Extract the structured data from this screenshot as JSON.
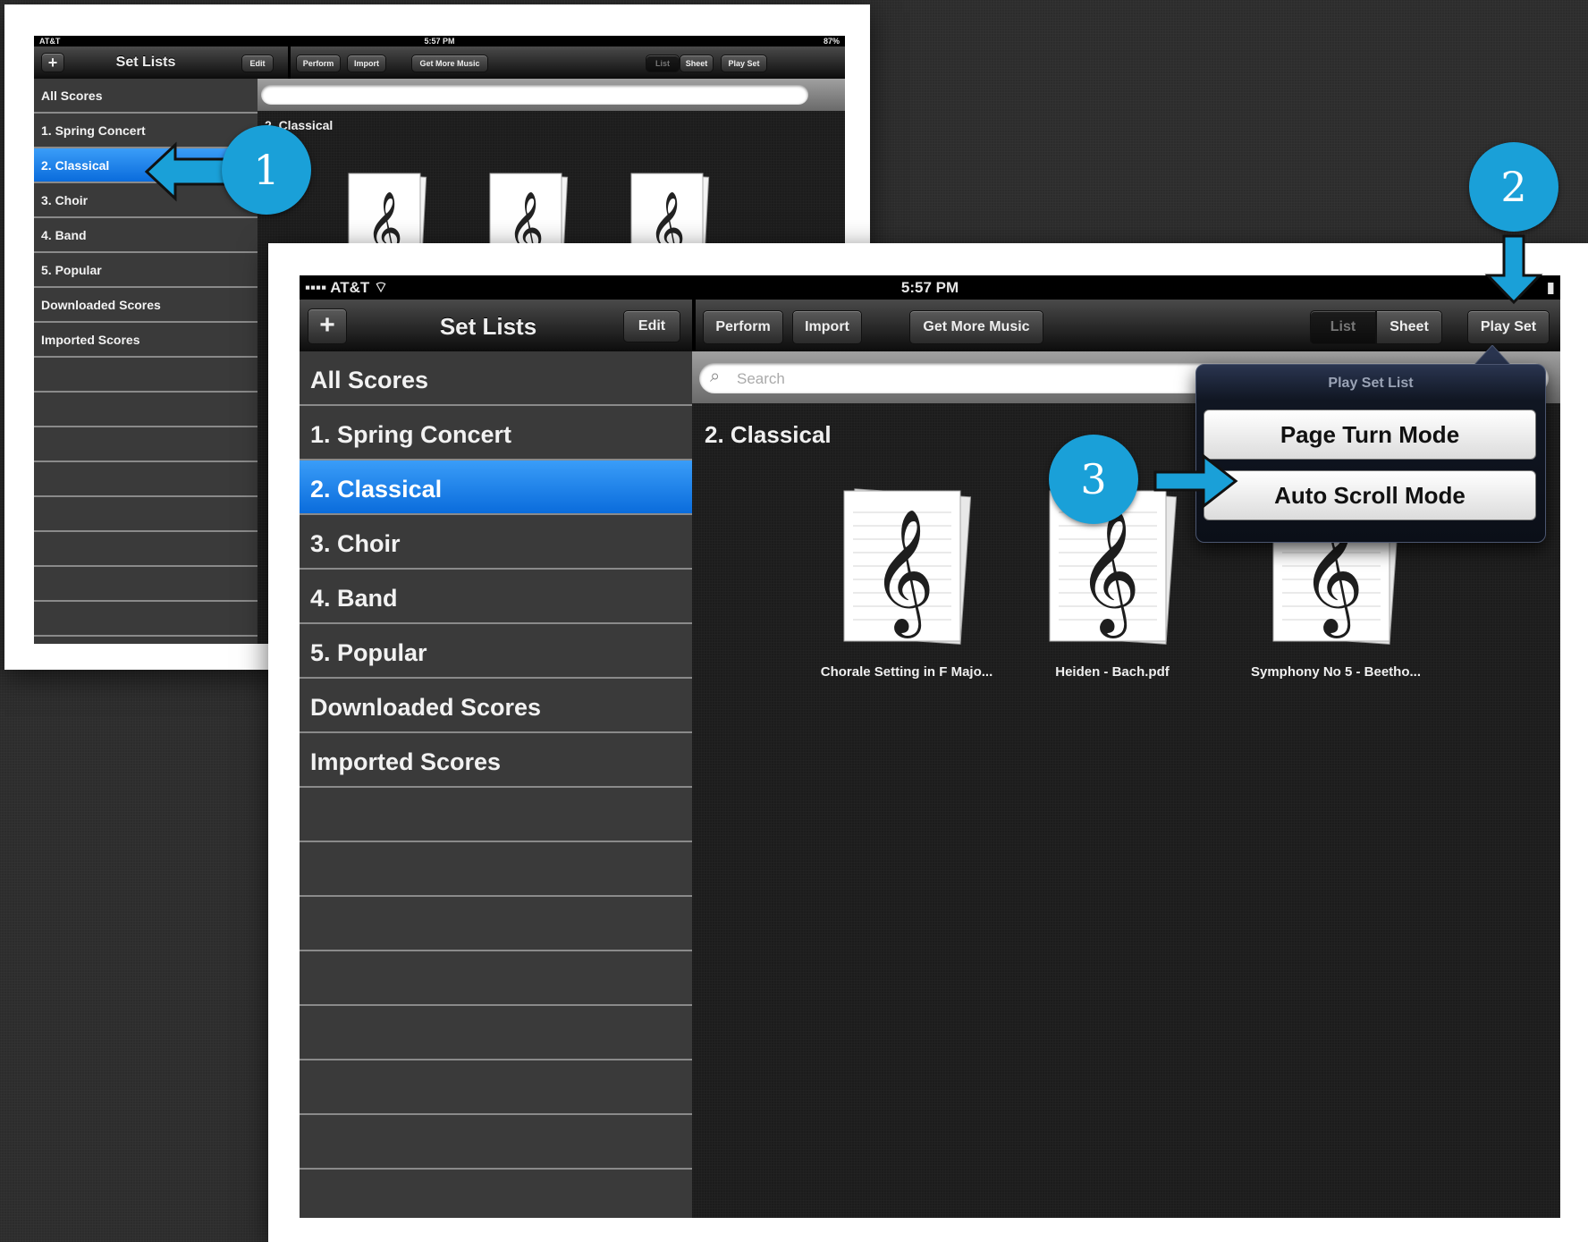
{
  "status": {
    "carrier": "AT&T",
    "time": "5:57 PM",
    "battery": "87%"
  },
  "small_status": {
    "carrier": "AT&T",
    "time": "5:57 PM",
    "battery": "87%"
  },
  "sidebar": {
    "title": "Set Lists",
    "add_label": "+",
    "edit_label": "Edit",
    "items": [
      "All Scores",
      "1. Spring Concert",
      "2. Classical",
      "3. Choir",
      "4. Band",
      "5. Popular",
      "Downloaded Scores",
      "Imported Scores"
    ],
    "selected_index": 2
  },
  "toolbar": {
    "perform_label": "Perform",
    "import_label": "Import",
    "get_more_label": "Get More Music",
    "list_label": "List",
    "sheet_label": "Sheet",
    "play_set_label": "Play Set"
  },
  "search": {
    "placeholder": "Search"
  },
  "content": {
    "section_title": "2. Classical",
    "scores": [
      "Chorale Setting in F Majo...",
      "Heiden - Bach.pdf",
      "Symphony No 5 - Beetho..."
    ]
  },
  "popover": {
    "title": "Play Set List",
    "page_turn_label": "Page Turn Mode",
    "auto_scroll_label": "Auto Scroll Mode"
  },
  "callouts": {
    "one": "1",
    "two": "2",
    "three": "3"
  },
  "colors": {
    "accent_blue": "#1aa0d8",
    "selection_blue": "#0a6cdc"
  }
}
